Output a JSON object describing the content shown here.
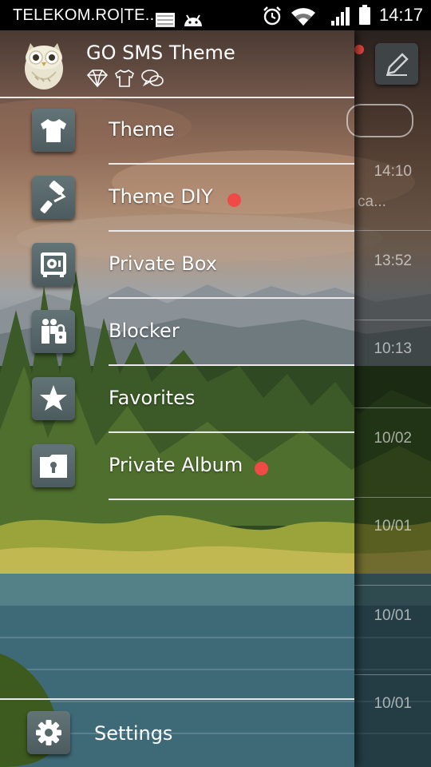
{
  "status_bar": {
    "carrier": "TELEKOM.RO|TE...",
    "time": "14:17",
    "icons": [
      "image-notification-icon",
      "android-debug-icon",
      "alarm-icon",
      "wifi-icon",
      "signal-icon",
      "battery-icon"
    ]
  },
  "drawer": {
    "app_title": "GO SMS Theme",
    "badges": [
      "diamond-icon",
      "tshirt-icon",
      "chat-bubbles-icon"
    ],
    "menu": [
      {
        "label": "Theme",
        "icon": "tshirt-icon",
        "new": false
      },
      {
        "label": "Theme DIY",
        "icon": "paint-roller-icon",
        "new": true
      },
      {
        "label": "Private Box",
        "icon": "safe-icon",
        "new": false
      },
      {
        "label": "Blocker",
        "icon": "blocked-contacts-icon",
        "new": false
      },
      {
        "label": "Favorites",
        "icon": "star-icon",
        "new": false
      },
      {
        "label": "Private Album",
        "icon": "locked-folder-icon",
        "new": true
      }
    ],
    "settings_label": "Settings",
    "new_dot_color": "#ef4a45"
  },
  "conversations": {
    "snippet": "ca...",
    "times": [
      "14:10",
      "13:52",
      "10:13",
      "10/02",
      "10/01",
      "10/01",
      "10/01"
    ]
  }
}
